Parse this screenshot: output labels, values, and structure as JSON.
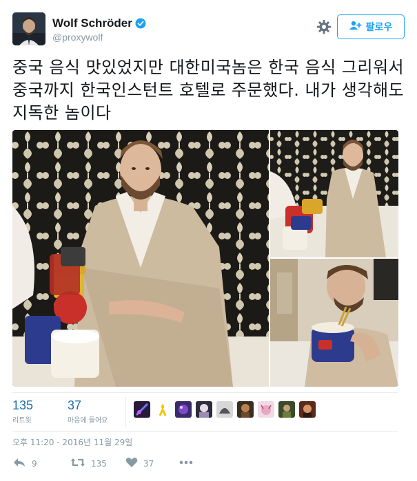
{
  "user": {
    "display_name": "Wolf Schröder",
    "handle": "@proxywolf"
  },
  "follow_button": {
    "label": "팔로우",
    "icon": "add-user-icon"
  },
  "tweet": {
    "text": "중국 음식 맛있었지만 대한미국놈은 한국 음식 그리워서 중국까지 한국인스턴트 호텔로 주문했다. 내가 생각해도 지독한 놈이다"
  },
  "stats": {
    "retweets": {
      "count": "135",
      "label": "리트윗"
    },
    "likes": {
      "count": "37",
      "label": "마음에 들어요"
    }
  },
  "timestamp": "오후 11:20 - 2016년 11월 29일",
  "actions": {
    "reply": {
      "icon": "reply-icon",
      "count": "9"
    },
    "retweet": {
      "icon": "retweet-icon",
      "count": "135"
    },
    "like": {
      "icon": "heart-icon",
      "count": "37"
    },
    "more": {
      "icon": "more-icon"
    }
  },
  "colors": {
    "accent": "#1da1f2",
    "stat_number": "#1b6fa8",
    "muted": "#8899a6",
    "text": "#14171a"
  }
}
